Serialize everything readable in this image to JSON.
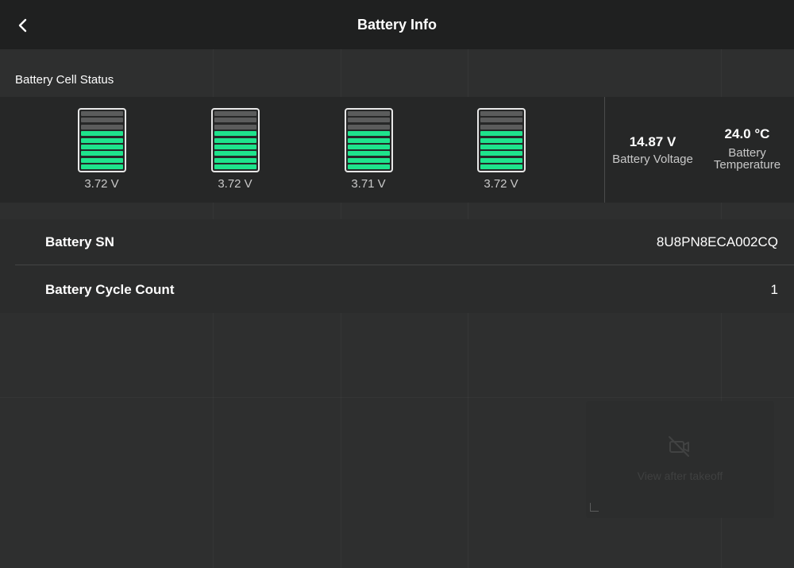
{
  "header": {
    "title": "Battery Info"
  },
  "cell_status": {
    "label": "Battery Cell Status",
    "cells": [
      {
        "voltage": "3.72 V",
        "level": 6,
        "segments": 9
      },
      {
        "voltage": "3.72 V",
        "level": 6,
        "segments": 9
      },
      {
        "voltage": "3.71 V",
        "level": 6,
        "segments": 9
      },
      {
        "voltage": "3.72 V",
        "level": 6,
        "segments": 9
      }
    ],
    "voltage": {
      "value": "14.87 V",
      "label": "Battery Voltage"
    },
    "temperature": {
      "value": "24.0 °C",
      "label_line1": "Battery",
      "label_line2": "Temperature"
    }
  },
  "info": {
    "rows": [
      {
        "label": "Battery SN",
        "value": "8U8PN8ECA002CQ"
      },
      {
        "label": "Battery Cycle Count",
        "value": "1"
      }
    ]
  },
  "pip": {
    "text": "View after takeoff",
    "icon": "camera-off-icon"
  },
  "colors": {
    "cell_full": "#1ee38c",
    "cell_empty": "#5b5c5c"
  }
}
